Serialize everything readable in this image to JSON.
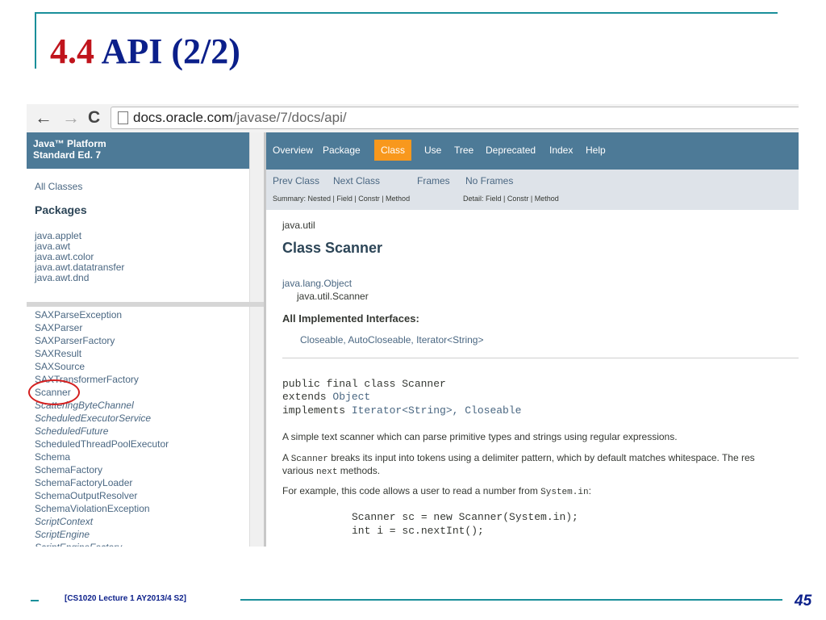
{
  "slide": {
    "title_number": "4.4",
    "title_text": "API (2/2)",
    "footer_text": "[CS1020 Lecture 1 AY2013/4 S2]",
    "page_number": "45"
  },
  "browser": {
    "url_host": "docs.oracle.com",
    "url_path": "/javase/7/docs/api/"
  },
  "left_frame": {
    "platform_line1": "Java™ Platform",
    "platform_line2": "Standard Ed. 7",
    "all_classes": "All Classes",
    "packages_heading": "Packages",
    "packages": [
      "java.applet",
      "java.awt",
      "java.awt.color",
      "java.awt.datatransfer",
      "java.awt.dnd"
    ],
    "classes": [
      {
        "name": "SAXParseException",
        "italic": false
      },
      {
        "name": "SAXParser",
        "italic": false
      },
      {
        "name": "SAXParserFactory",
        "italic": false
      },
      {
        "name": "SAXResult",
        "italic": false
      },
      {
        "name": "SAXSource",
        "italic": false
      },
      {
        "name": "SAXTransformerFactory",
        "italic": false
      },
      {
        "name": "Scanner",
        "italic": false
      },
      {
        "name": "ScatteringByteChannel",
        "italic": true
      },
      {
        "name": "ScheduledExecutorService",
        "italic": true
      },
      {
        "name": "ScheduledFuture",
        "italic": true
      },
      {
        "name": "ScheduledThreadPoolExecutor",
        "italic": false
      },
      {
        "name": "Schema",
        "italic": false
      },
      {
        "name": "SchemaFactory",
        "italic": false
      },
      {
        "name": "SchemaFactoryLoader",
        "italic": false
      },
      {
        "name": "SchemaOutputResolver",
        "italic": false
      },
      {
        "name": "SchemaViolationException",
        "italic": false
      },
      {
        "name": "ScriptContext",
        "italic": true
      },
      {
        "name": "ScriptEngine",
        "italic": true
      },
      {
        "name": "ScriptEngineFactory",
        "italic": true
      }
    ]
  },
  "topnav": {
    "overview": "Overview",
    "package": "Package",
    "class": "Class",
    "use": "Use",
    "tree": "Tree",
    "deprecated": "Deprecated",
    "index": "Index",
    "help": "Help"
  },
  "subnav": {
    "prev_class": "Prev Class",
    "next_class": "Next Class",
    "frames": "Frames",
    "no_frames": "No Frames",
    "summary": "Summary: Nested | Field | Constr | Method",
    "detail": "Detail: Field | Constr | Method"
  },
  "content": {
    "package_name": "java.util",
    "class_title": "Class Scanner",
    "inheritance_1": "java.lang.Object",
    "inheritance_2": "java.util.Scanner",
    "implemented_heading": "All Implemented Interfaces:",
    "implemented_list": "Closeable, AutoCloseable, Iterator<String>",
    "sig_line1": "public final class Scanner",
    "sig_extends_kw": "extends ",
    "sig_extends_type": "Object",
    "sig_implements_kw": "implements ",
    "sig_implements_types": "Iterator<String>, Closeable",
    "desc1": "A simple text scanner which can parse primitive types and strings using regular expressions.",
    "desc2_pre": "A ",
    "desc2_code": "Scanner",
    "desc2_post": " breaks its input into tokens using a delimiter pattern, which by default matches whitespace. The res",
    "desc3_pre": "various ",
    "desc3_code": "next",
    "desc3_post": " methods.",
    "desc4_pre": "For example, this code allows a user to read a number from ",
    "desc4_code": "System.in",
    "desc4_post": ":",
    "code1": "Scanner sc = new Scanner(System.in);",
    "code2": "int i = sc.nextInt();"
  },
  "colors": {
    "title_red": "#c0141c",
    "title_blue": "#0b1f8a",
    "accent_teal": "#1a8f9a",
    "javadoc_header": "#4d7a97",
    "javadoc_active_tab": "#f8981d",
    "highlight_circle": "#d41f1f"
  }
}
